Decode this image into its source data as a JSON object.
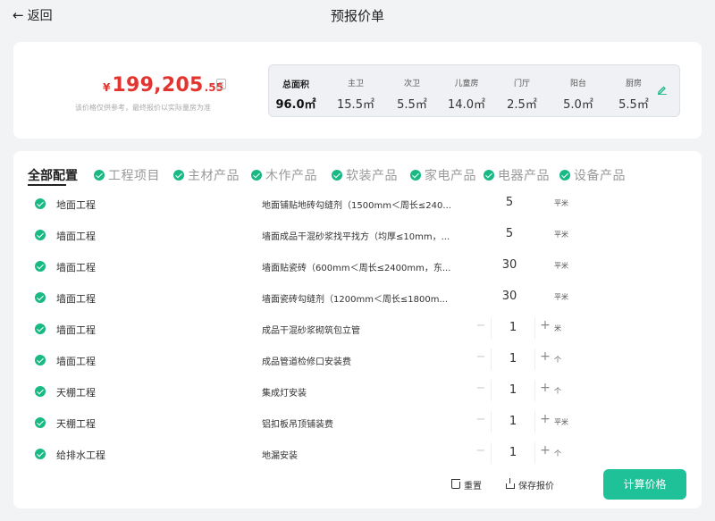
{
  "header": {
    "back_label": "返回",
    "title": "预报价单"
  },
  "summary": {
    "currency": "¥",
    "price_int": "199,205",
    "price_dec": ".55",
    "note": "该价格仅供参考，最终报价以实际量房为准",
    "areas": [
      {
        "label": "总面积",
        "value": "96.0㎡"
      },
      {
        "label": "主卫",
        "value": "15.5㎡"
      },
      {
        "label": "次卫",
        "value": "5.5㎡"
      },
      {
        "label": "儿童房",
        "value": "14.0㎡"
      },
      {
        "label": "门厅",
        "value": "2.5㎡"
      },
      {
        "label": "阳台",
        "value": "5.0㎡"
      },
      {
        "label": "厨房",
        "value": "5.5㎡"
      }
    ]
  },
  "tabs": [
    {
      "label": "全部配置",
      "active": true
    },
    {
      "label": "工程项目"
    },
    {
      "label": "主材产品"
    },
    {
      "label": "木作产品"
    },
    {
      "label": "软装产品"
    },
    {
      "label": "家电产品"
    },
    {
      "label": "电器产品"
    },
    {
      "label": "设备产品"
    }
  ],
  "rows": [
    {
      "category": "地面工程",
      "item": "地面铺贴地砖勾缝剂（1500mm＜周长≤240...",
      "qty": "5",
      "unit": "平米",
      "stepper": false
    },
    {
      "category": "墙面工程",
      "item": "墙面成品干混砂浆找平找方（均厚≤10mm，...",
      "qty": "5",
      "unit": "平米",
      "stepper": false
    },
    {
      "category": "墙面工程",
      "item": "墙面贴瓷砖（600mm＜周长≤2400mm，东...",
      "qty": "30",
      "unit": "平米",
      "stepper": false
    },
    {
      "category": "墙面工程",
      "item": "墙面瓷砖勾缝剂（1200mm＜周长≤1800m...",
      "qty": "30",
      "unit": "平米",
      "stepper": false
    },
    {
      "category": "墙面工程",
      "item": "成品干混砂浆砌筑包立管",
      "qty": "1",
      "unit": "米",
      "stepper": true
    },
    {
      "category": "墙面工程",
      "item": "成品管道检修口安装费",
      "qty": "1",
      "unit": "个",
      "stepper": true
    },
    {
      "category": "天棚工程",
      "item": "集成灯安装",
      "qty": "1",
      "unit": "个",
      "stepper": true
    },
    {
      "category": "天棚工程",
      "item": "铝扣板吊顶铺装费",
      "qty": "1",
      "unit": "平米",
      "stepper": true
    },
    {
      "category": "给排水工程",
      "item": "地漏安装",
      "qty": "1",
      "unit": "个",
      "stepper": true
    }
  ],
  "stepper_symbols": {
    "minus": "−",
    "plus": "+"
  },
  "actions": {
    "reset": "重置",
    "save": "保存报价",
    "calc": "计算价格"
  },
  "colors": {
    "accent": "#1fc199",
    "price": "#e3342f",
    "check": "#19b985"
  }
}
